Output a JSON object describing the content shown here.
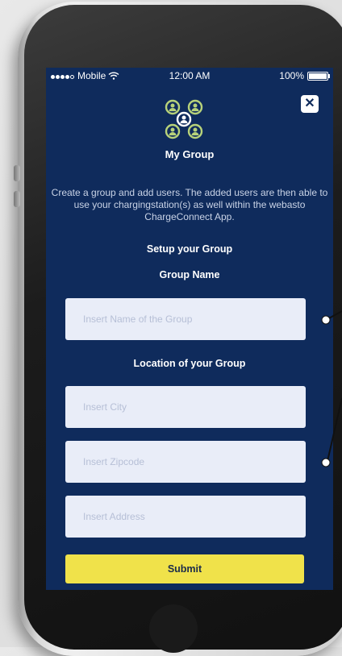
{
  "status_bar": {
    "carrier": "Mobile",
    "time": "12:00 AM",
    "battery": "100%"
  },
  "header": {
    "title": "My Group",
    "close_label": "✕",
    "icon": "group-users-icon"
  },
  "description": "Create a group and add users. The added users are then able to use your chargingstation(s) as well within the webasto ChargeConnect App.",
  "form": {
    "setup_heading": "Setup your Group",
    "group_name_label": "Group Name",
    "group_name_placeholder": "Insert Name of the Group",
    "location_heading": "Location of your Group",
    "city_placeholder": "Insert City",
    "zipcode_placeholder": "Insert Zipcode",
    "address_placeholder": "Insert Address",
    "submit_label": "Submit"
  },
  "colors": {
    "background": "#0f2b5c",
    "accent": "#f0e24a",
    "field": "#e9edf8",
    "icon_green": "#b7d27a"
  }
}
